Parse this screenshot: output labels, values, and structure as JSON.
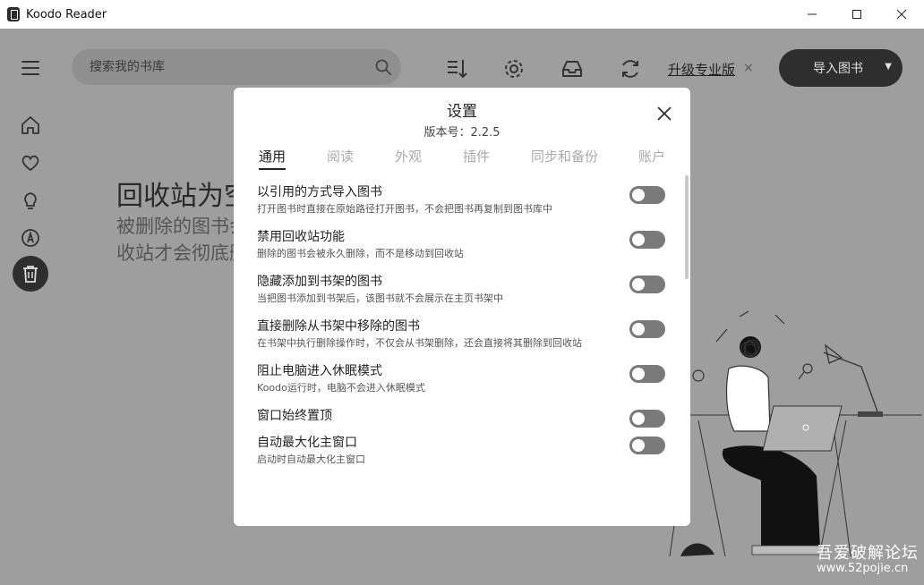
{
  "window": {
    "title": "Koodo Reader",
    "minimize": "—",
    "maximize": "☐",
    "close": "✕"
  },
  "header": {
    "search_placeholder": "搜索我的书库",
    "upgrade_label": "升级专业版",
    "upgrade_close": "×",
    "import_label": "导入图书",
    "import_caret": "▼"
  },
  "main": {
    "title": "回收站为空",
    "desc_line1": "被删除的图书会被移到回收站，",
    "desc_line2": "收站才会彻底删除"
  },
  "modal": {
    "title": "设置",
    "version": "版本号：2.2.5",
    "tabs": [
      {
        "label": "通用",
        "active": true
      },
      {
        "label": "阅读",
        "active": false
      },
      {
        "label": "外观",
        "active": false
      },
      {
        "label": "插件",
        "active": false
      },
      {
        "label": "同步和备份",
        "active": false
      },
      {
        "label": "账户",
        "active": false
      }
    ],
    "settings": [
      {
        "title": "以引用的方式导入图书",
        "desc": "打开图书时直接在原始路径打开图书，不会把图书再复制到图书库中",
        "enabled": false
      },
      {
        "title": "禁用回收站功能",
        "desc": "删除的图书会被永久删除，而不是移动到回收站",
        "enabled": false
      },
      {
        "title": "隐藏添加到书架的图书",
        "desc": "当把图书添加到书架后，该图书就不会展示在主页书架中",
        "enabled": false
      },
      {
        "title": "直接删除从书架中移除的图书",
        "desc": "在书架中执行删除操作时，不仅会从书架删除，还会直接将其删除到回收站",
        "enabled": false
      },
      {
        "title": "阻止电脑进入休眠模式",
        "desc": "Koodo运行时，电脑不会进入休眠模式",
        "enabled": false
      },
      {
        "title": "窗口始终置顶",
        "desc": "",
        "enabled": false
      },
      {
        "title": "自动最大化主窗口",
        "desc": "启动时自动最大化主窗口",
        "enabled": false
      }
    ]
  },
  "watermark": {
    "line1": "吾爱破解论坛",
    "line2": "www.52pojie.cn"
  }
}
